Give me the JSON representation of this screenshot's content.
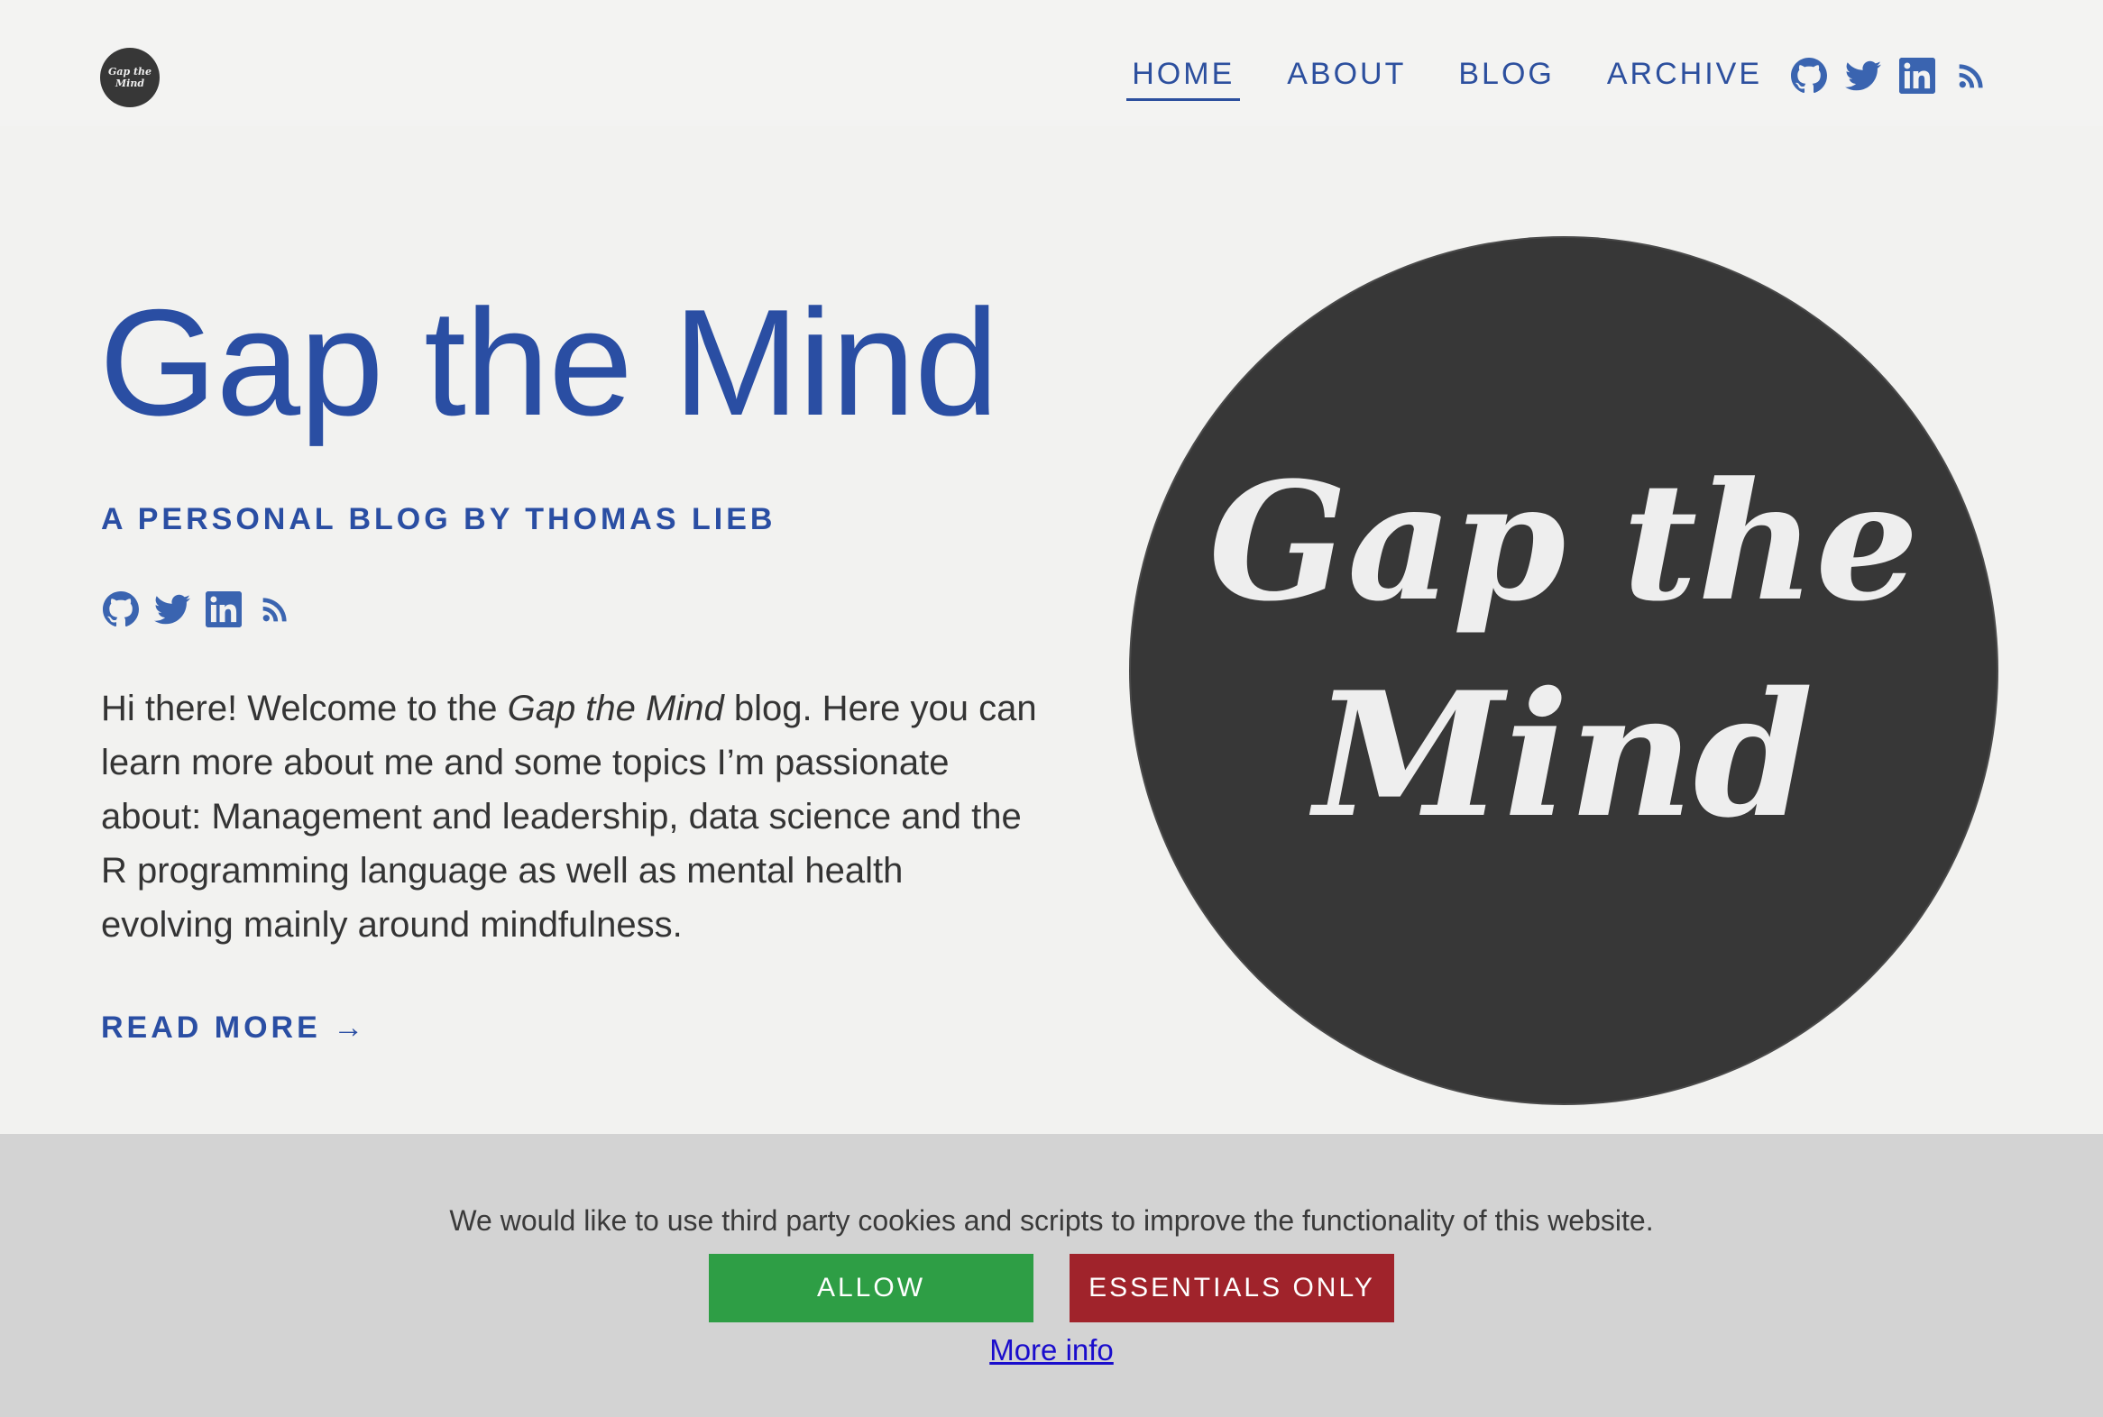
{
  "header": {
    "logo_line1": "Gap the",
    "logo_line2": "Mind",
    "nav": [
      {
        "label": "HOME",
        "active": true
      },
      {
        "label": "ABOUT",
        "active": false
      },
      {
        "label": "BLOG",
        "active": false
      },
      {
        "label": "ARCHIVE",
        "active": false
      }
    ],
    "social_icons": [
      "github-icon",
      "twitter-icon",
      "linkedin-icon",
      "rss-icon"
    ]
  },
  "hero": {
    "title": "Gap the Mind",
    "subtitle": "A PERSONAL BLOG BY THOMAS LIEB",
    "social_icons": [
      "github-icon",
      "twitter-icon",
      "linkedin-icon",
      "rss-icon"
    ],
    "intro_before": "Hi there! Welcome to the ",
    "intro_emphasis": "Gap the Mind",
    "intro_after": " blog. Here you can learn more about me and some topics I’m passionate about: Management and leadership, data science and the R programming language as well as mental health evolving mainly around mindfulness.",
    "read_more": "READ MORE →",
    "logo_line1": "Gap the",
    "logo_line2": "Mind"
  },
  "cookie_banner": {
    "message": "We would like to use third party cookies and scripts to improve the functionality of this website.",
    "allow_label": "ALLOW",
    "essentials_label": "ESSENTIALS ONLY",
    "more_info_label": "More info"
  },
  "colors": {
    "brand_blue": "#2a4ea3",
    "background": "#f2f2f0",
    "logo_dark": "#373737",
    "allow_green": "#2e9e45",
    "essentials_red": "#a0232b",
    "banner_gray": "#d3d3d3"
  }
}
